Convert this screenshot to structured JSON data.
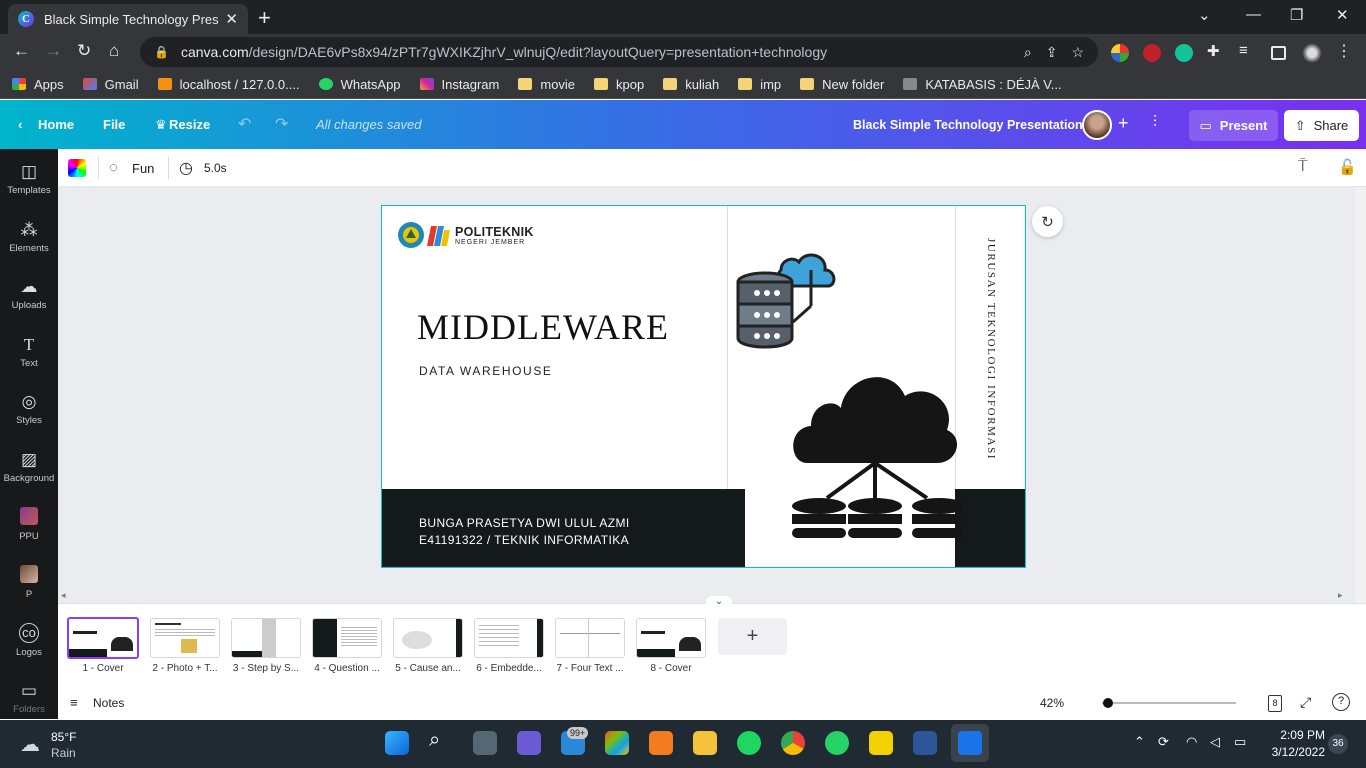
{
  "browser": {
    "tab_title": "Black Simple Technology Presentat",
    "new_tab": "+",
    "url_host": "canva.com",
    "url_path": "/design/DAE6vPs8x94/zPTr7gWXIKZjhrV_wlnujQ/edit?layoutQuery=presentation+technology",
    "bookmarks": [
      {
        "label": "Apps",
        "icon": "apps-grid-icon"
      },
      {
        "label": "Gmail",
        "icon": "gmail-icon"
      },
      {
        "label": "localhost / 127.0.0....",
        "icon": "phpmyadmin-icon"
      },
      {
        "label": "WhatsApp",
        "icon": "whatsapp-icon"
      },
      {
        "label": "Instagram",
        "icon": "instagram-icon"
      },
      {
        "label": "movie",
        "icon": "folder-icon"
      },
      {
        "label": "kpop",
        "icon": "folder-icon"
      },
      {
        "label": "kuliah",
        "icon": "folder-icon"
      },
      {
        "label": "imp",
        "icon": "folder-icon"
      },
      {
        "label": "New folder",
        "icon": "folder-icon"
      },
      {
        "label": "KATABASIS : DÉJÀ V...",
        "icon": "page-icon"
      }
    ]
  },
  "canva": {
    "home": "Home",
    "file": "File",
    "resize": "Resize",
    "saved": "All changes saved",
    "doc_title": "Black Simple Technology Presentation",
    "present": "Present",
    "share": "Share",
    "plus": "+",
    "animation": "Fun",
    "duration": "5.0s"
  },
  "rail": [
    {
      "label": "Templates",
      "icon": "templates-icon"
    },
    {
      "label": "Elements",
      "icon": "elements-icon"
    },
    {
      "label": "Uploads",
      "icon": "uploads-icon"
    },
    {
      "label": "Text",
      "icon": "text-icon"
    },
    {
      "label": "Styles",
      "icon": "styles-icon"
    },
    {
      "label": "Background",
      "icon": "background-icon"
    },
    {
      "label": "PPU",
      "icon": "ppu-app-icon"
    },
    {
      "label": "P",
      "icon": "p-app-icon"
    },
    {
      "label": "Logos",
      "icon": "logos-icon"
    },
    {
      "label": "Folders",
      "icon": "folders-icon"
    }
  ],
  "slide": {
    "logo_line1": "POLITEKNIK",
    "logo_line2": "NEGERI JEMBER",
    "title": "MIDDLEWARE",
    "subtitle": "DATA WAREHOUSE",
    "author": "BUNGA PRASETYA DWI ULUL AZMI",
    "id_dept": "E41191322 / TEKNIK INFORMATIKA",
    "vertical": "JURUSAN TEKNOLOGI INFORMASI"
  },
  "pages": [
    {
      "label": "1 - Cover",
      "selected": true
    },
    {
      "label": "2 - Photo + T...",
      "selected": false
    },
    {
      "label": "3 - Step by S...",
      "selected": false
    },
    {
      "label": "4 - Question ...",
      "selected": false
    },
    {
      "label": "5 - Cause an...",
      "selected": false
    },
    {
      "label": "6 - Embedde...",
      "selected": false
    },
    {
      "label": "7 - Four Text ...",
      "selected": false
    },
    {
      "label": "8 - Cover",
      "selected": false
    }
  ],
  "bottom": {
    "notes": "Notes",
    "zoom": "42%",
    "zoom_level": 0.42,
    "page_count": "8"
  },
  "taskbar": {
    "temp": "85°F",
    "weather": "Rain",
    "mail_badge": "99+",
    "time": "2:09 PM",
    "date": "3/12/2022",
    "notif": "36"
  },
  "colors": {
    "accent": "#8b3dff",
    "slide_dark": "#14191c",
    "selection": "#00c4cc"
  }
}
